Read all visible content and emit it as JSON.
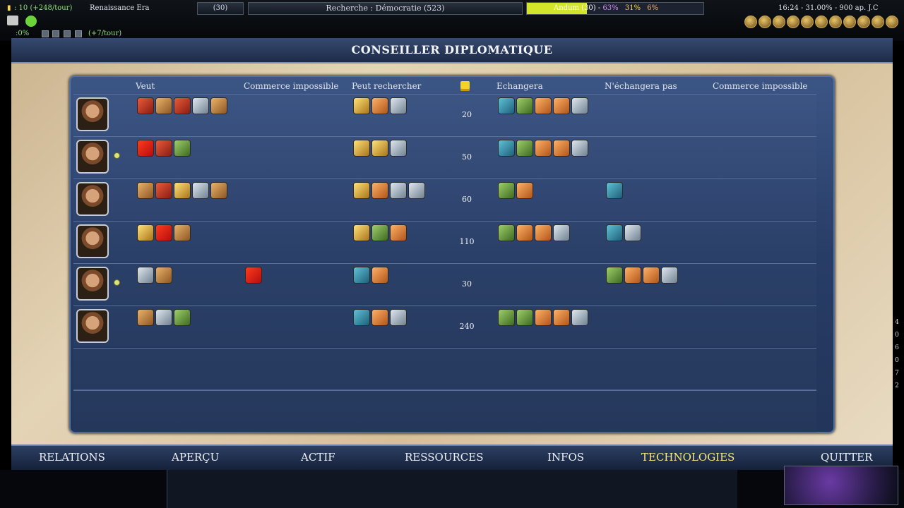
{
  "hud": {
    "gold_rate": ": 10 (+248/tour)",
    "era": "Renaissance Era",
    "population": "(30)",
    "research": "Recherche : Démocratie (523)",
    "religion_status": "Andum (30) - ",
    "stat_a": "63%",
    "stat_b": "31%",
    "stat_c": "6%",
    "clock_date": "16:24 - 31.00% - 900 ap. J.C",
    "culture_rate": ":0%",
    "culture_gain": "(+7/tour)"
  },
  "window_title": "CONSEILLER DIPLOMATIQUE",
  "columns": {
    "wants": "Veut",
    "trade_impossible_1": "Commerce impossible",
    "can_research": "Peut rechercher",
    "will_trade": "Echangera",
    "wont_trade": "N'échangera pas",
    "trade_impossible_2": "Commerce impossible"
  },
  "rows": [
    {
      "peace": false,
      "gold": "20",
      "wants": [
        "red",
        "brown",
        "red",
        "silver",
        "brown"
      ],
      "impossible": [],
      "research": [
        "gold",
        "orange",
        "silver"
      ],
      "trade": [
        "teal",
        "green",
        "orange",
        "orange",
        "silver"
      ],
      "no_trade": []
    },
    {
      "peace": true,
      "gold": "50",
      "wants": [
        "flag",
        "red",
        "green"
      ],
      "impossible": [],
      "research": [
        "gold",
        "gold",
        "silver"
      ],
      "trade": [
        "teal",
        "green",
        "orange",
        "orange",
        "silver"
      ],
      "no_trade": []
    },
    {
      "peace": false,
      "gold": "60",
      "wants": [
        "brown",
        "red",
        "gold",
        "silver",
        "brown"
      ],
      "impossible": [],
      "research": [
        "gold",
        "orange",
        "silver",
        "silver"
      ],
      "trade": [
        "green",
        "orange"
      ],
      "no_trade": [
        "teal"
      ]
    },
    {
      "peace": false,
      "gold": "110",
      "wants": [
        "gold",
        "flag",
        "brown"
      ],
      "impossible": [],
      "research": [
        "gold",
        "green",
        "orange"
      ],
      "trade": [
        "green",
        "orange",
        "orange",
        "silver"
      ],
      "no_trade": [
        "teal",
        "silver"
      ]
    },
    {
      "peace": true,
      "gold": "30",
      "wants": [
        "silver",
        "brown"
      ],
      "impossible": [
        "flag"
      ],
      "research": [
        "teal",
        "orange"
      ],
      "trade": [],
      "no_trade": [
        "green",
        "orange",
        "orange",
        "silver"
      ]
    },
    {
      "peace": false,
      "gold": "240",
      "wants": [
        "brown",
        "silver",
        "green"
      ],
      "impossible": [],
      "research": [
        "teal",
        "orange",
        "silver"
      ],
      "trade": [
        "green",
        "green",
        "orange",
        "orange",
        "silver"
      ],
      "no_trade": []
    }
  ],
  "tabs": [
    {
      "label": "RELATIONS",
      "active": false
    },
    {
      "label": "APERÇU",
      "active": false
    },
    {
      "label": "ACTIF",
      "active": false
    },
    {
      "label": "RESSOURCES",
      "active": false
    },
    {
      "label": "INFOS",
      "active": false
    },
    {
      "label": "TECHNOLOGIES",
      "active": true
    },
    {
      "label": "QUITTER",
      "active": false
    }
  ],
  "side_numbers": [
    "4",
    "0",
    "6",
    "0",
    "7",
    "2"
  ]
}
